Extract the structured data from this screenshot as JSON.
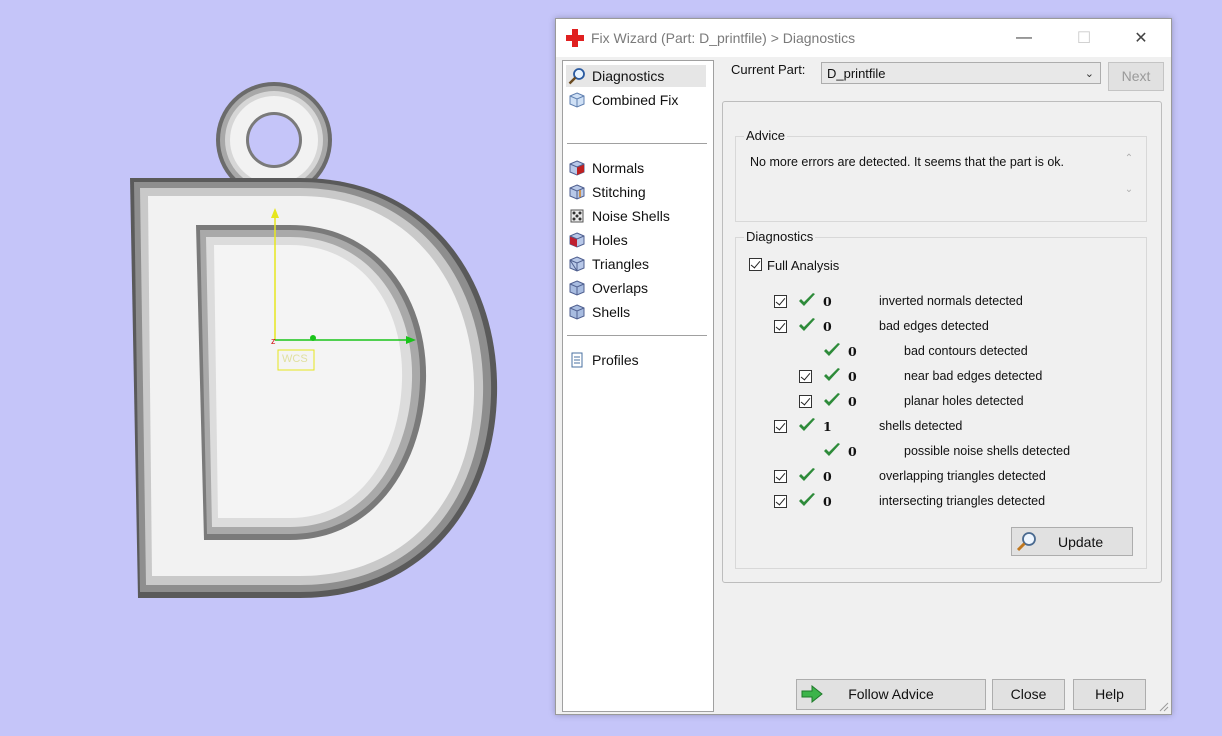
{
  "viewport": {
    "wcs_label": "WCS"
  },
  "window": {
    "title": "Fix Wizard (Part: D_printfile) > Diagnostics",
    "minimize": "—",
    "maximize": "☐",
    "close": "✕"
  },
  "nav": {
    "items": [
      {
        "label": "Diagnostics",
        "icon": "diagnostics-magnifier-icon",
        "selected": true
      },
      {
        "label": "Combined Fix",
        "icon": "combined-fix-cube-icon"
      },
      {
        "label": "Normals",
        "icon": "normals-cube-icon"
      },
      {
        "label": "Stitching",
        "icon": "stitching-cube-icon"
      },
      {
        "label": "Noise Shells",
        "icon": "noise-shells-icon"
      },
      {
        "label": "Holes",
        "icon": "holes-cube-icon"
      },
      {
        "label": "Triangles",
        "icon": "triangles-cube-icon"
      },
      {
        "label": "Overlaps",
        "icon": "overlaps-cube-icon"
      },
      {
        "label": "Shells",
        "icon": "shells-cube-icon"
      },
      {
        "label": "Profiles",
        "icon": "profiles-document-icon"
      }
    ]
  },
  "top": {
    "current_part_label": "Current Part:",
    "current_part_value": "D_printfile",
    "next_label": "Next"
  },
  "advice": {
    "title": "Advice",
    "text": "No more errors are detected. It seems that the part is ok."
  },
  "diagnostics": {
    "title": "Diagnostics",
    "full_analysis_label": "Full Analysis",
    "rows": [
      {
        "count": "0",
        "label": "inverted normals detected",
        "checkbox": true
      },
      {
        "count": "0",
        "label": "bad edges detected",
        "checkbox": true
      },
      {
        "count": "0",
        "label": "bad contours detected",
        "checkbox": false
      },
      {
        "count": "0",
        "label": "near bad edges detected",
        "checkbox": true
      },
      {
        "count": "0",
        "label": "planar holes detected",
        "checkbox": true
      },
      {
        "count": "1",
        "label": "shells detected",
        "checkbox": true
      },
      {
        "count": "0",
        "label": "possible noise shells detected",
        "checkbox": false
      },
      {
        "count": "0",
        "label": "overlapping triangles detected",
        "checkbox": true
      },
      {
        "count": "0",
        "label": "intersecting triangles detected",
        "checkbox": true
      }
    ],
    "update_label": "Update"
  },
  "footer": {
    "follow_advice_label": "Follow Advice",
    "close_label": "Close",
    "help_label": "Help"
  },
  "colors": {
    "background": "#c5c5f9",
    "check_green": "#2e8b3a",
    "axis_x": "#19c419",
    "axis_y": "#e6e61e",
    "axis_z": "#d01010"
  }
}
